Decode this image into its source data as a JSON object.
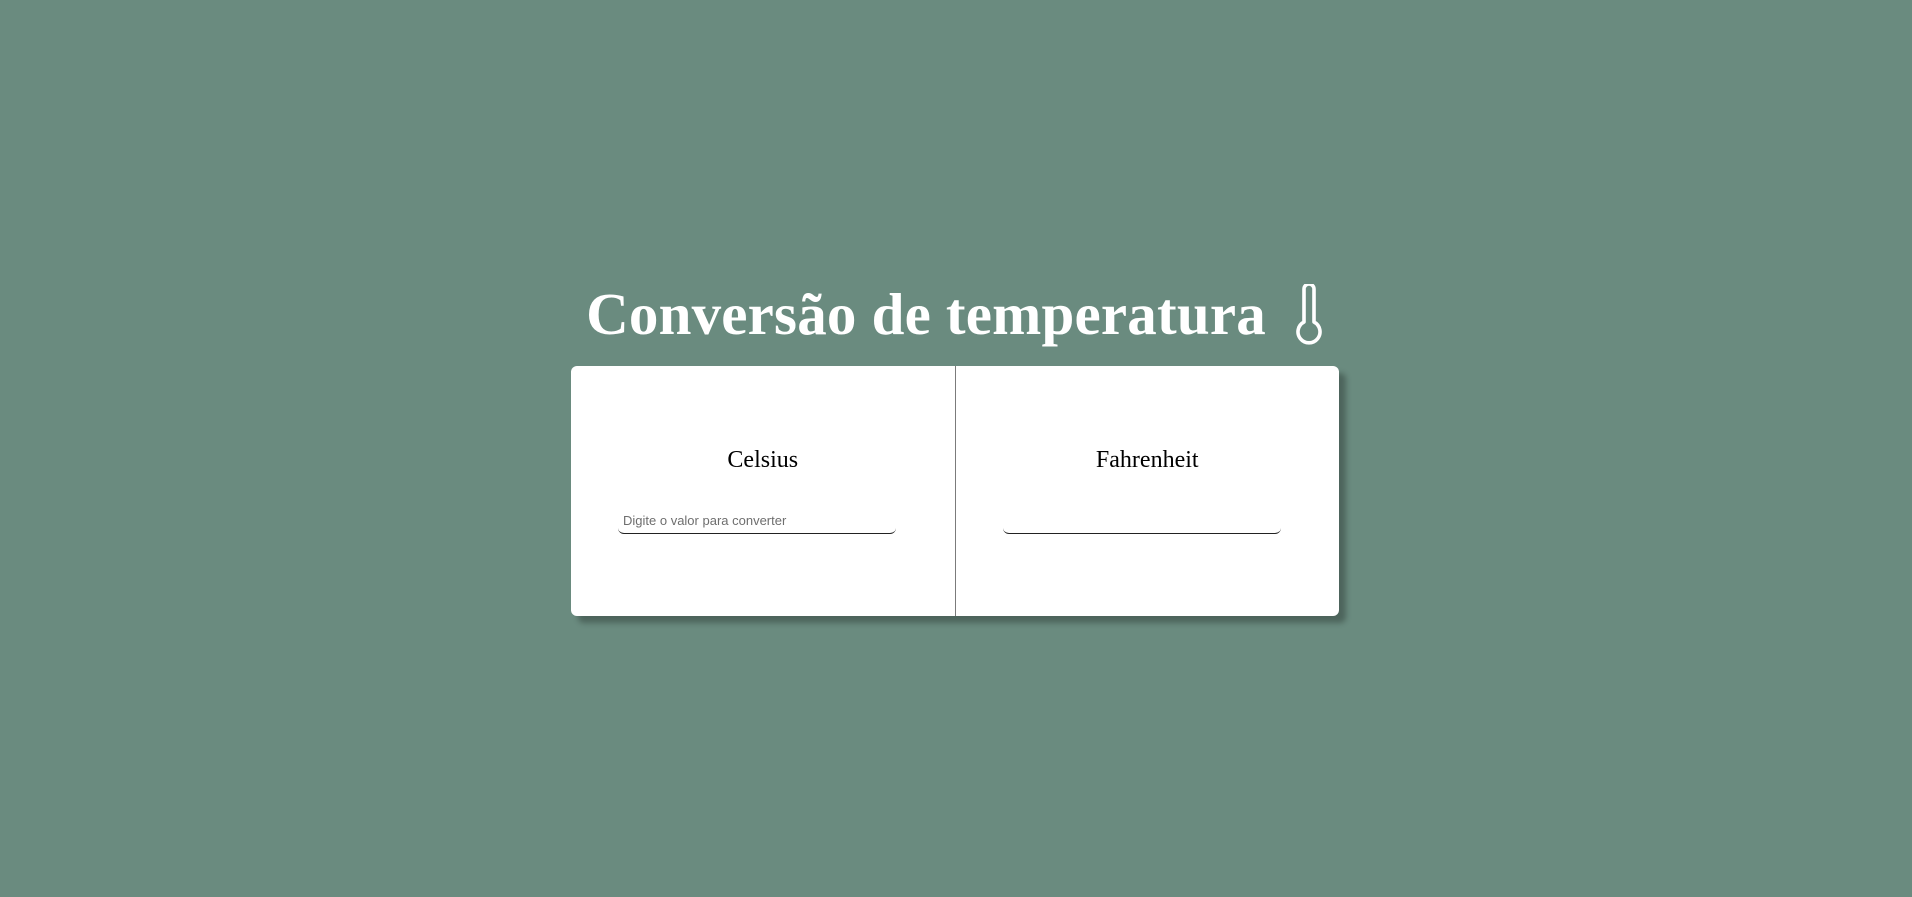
{
  "header": {
    "title": "Conversão de temperatura",
    "icon": "thermometer-icon"
  },
  "celsius": {
    "label": "Celsius",
    "value": "",
    "placeholder": "Digite o valor para converter"
  },
  "fahrenheit": {
    "label": "Fahrenheit",
    "value": "",
    "placeholder": ""
  },
  "colors": {
    "background": "#6a8b7f",
    "card": "#ffffff",
    "title": "#ffffff"
  }
}
